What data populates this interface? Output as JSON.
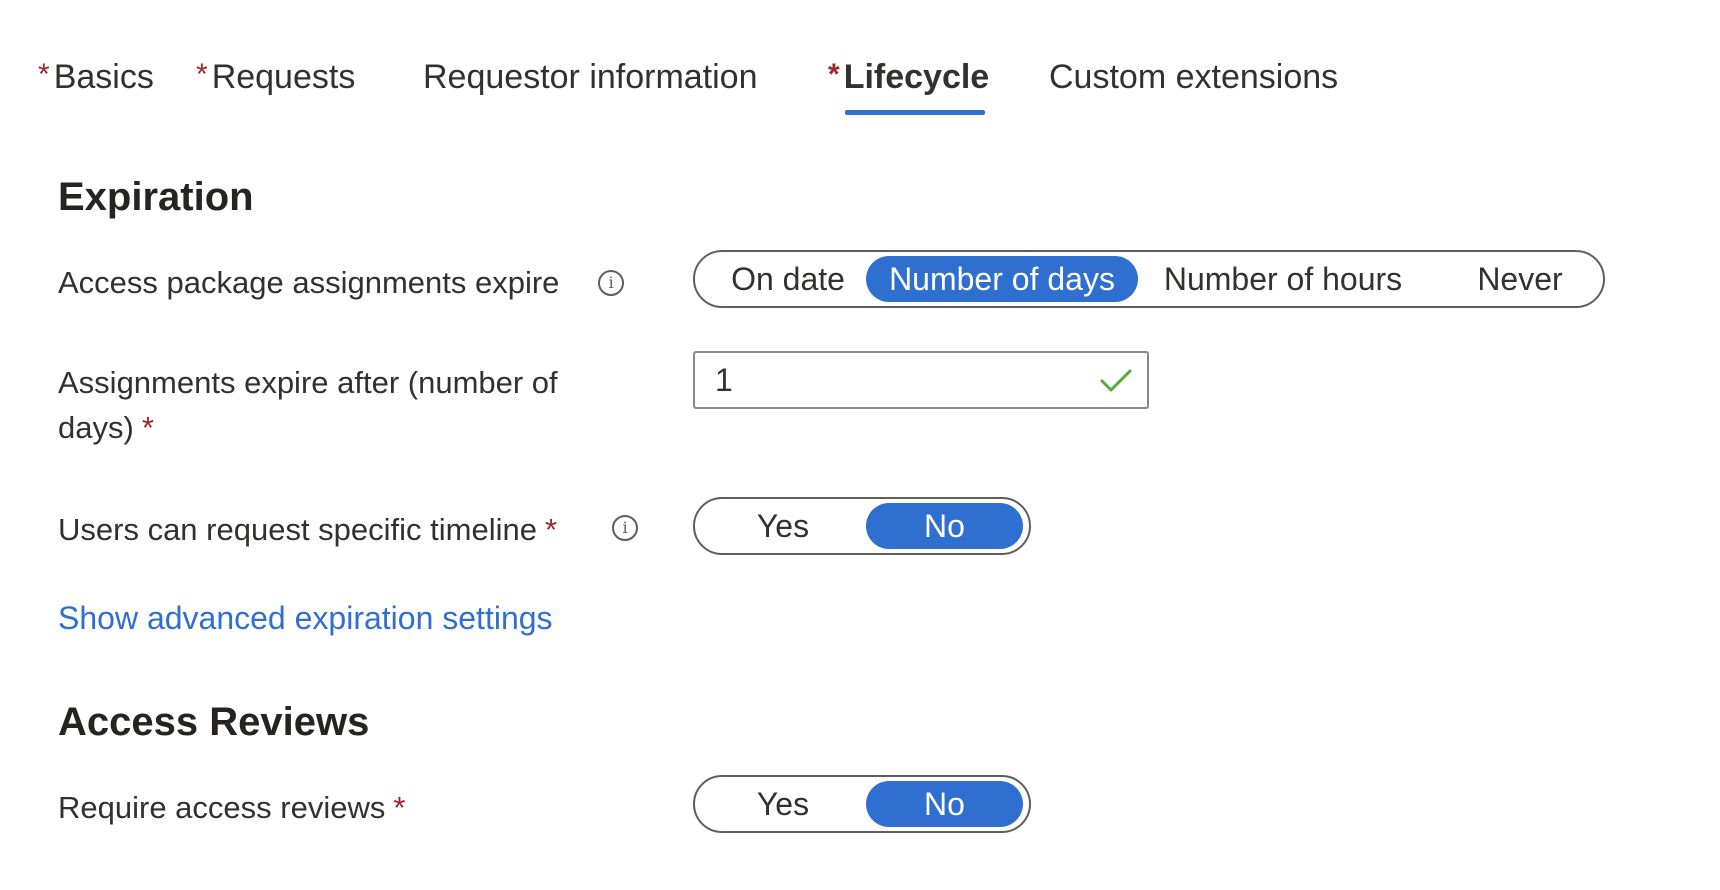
{
  "tabs": [
    {
      "label": "Basics",
      "required": true
    },
    {
      "label": "Requests",
      "required": true
    },
    {
      "label": "Requestor information",
      "required": false
    },
    {
      "label": "Lifecycle",
      "required": true,
      "active": true
    },
    {
      "label": "Custom extensions",
      "required": false
    }
  ],
  "required_marker": "*",
  "expiration": {
    "heading": "Expiration",
    "assignments_expire": {
      "label": "Access package assignments expire",
      "options": [
        "On date",
        "Number of days",
        "Number of hours",
        "Never"
      ],
      "selected": "Number of days",
      "info_icon": "info-icon"
    },
    "expire_after": {
      "label_line1": "Assignments expire after (number of",
      "label_line2": "days)",
      "value": "1",
      "valid_icon": "checkmark-icon"
    },
    "specific_timeline": {
      "label": "Users can request specific timeline",
      "options": [
        "Yes",
        "No"
      ],
      "selected": "No",
      "info_icon": "info-icon"
    },
    "advanced_link": "Show advanced expiration settings"
  },
  "access_reviews": {
    "heading": "Access Reviews",
    "require_reviews": {
      "label": "Require access reviews",
      "options": [
        "Yes",
        "No"
      ],
      "selected": "No"
    }
  },
  "colors": {
    "accent": "#2f6fcf",
    "required": "#a4262c",
    "valid": "#57a83d"
  }
}
